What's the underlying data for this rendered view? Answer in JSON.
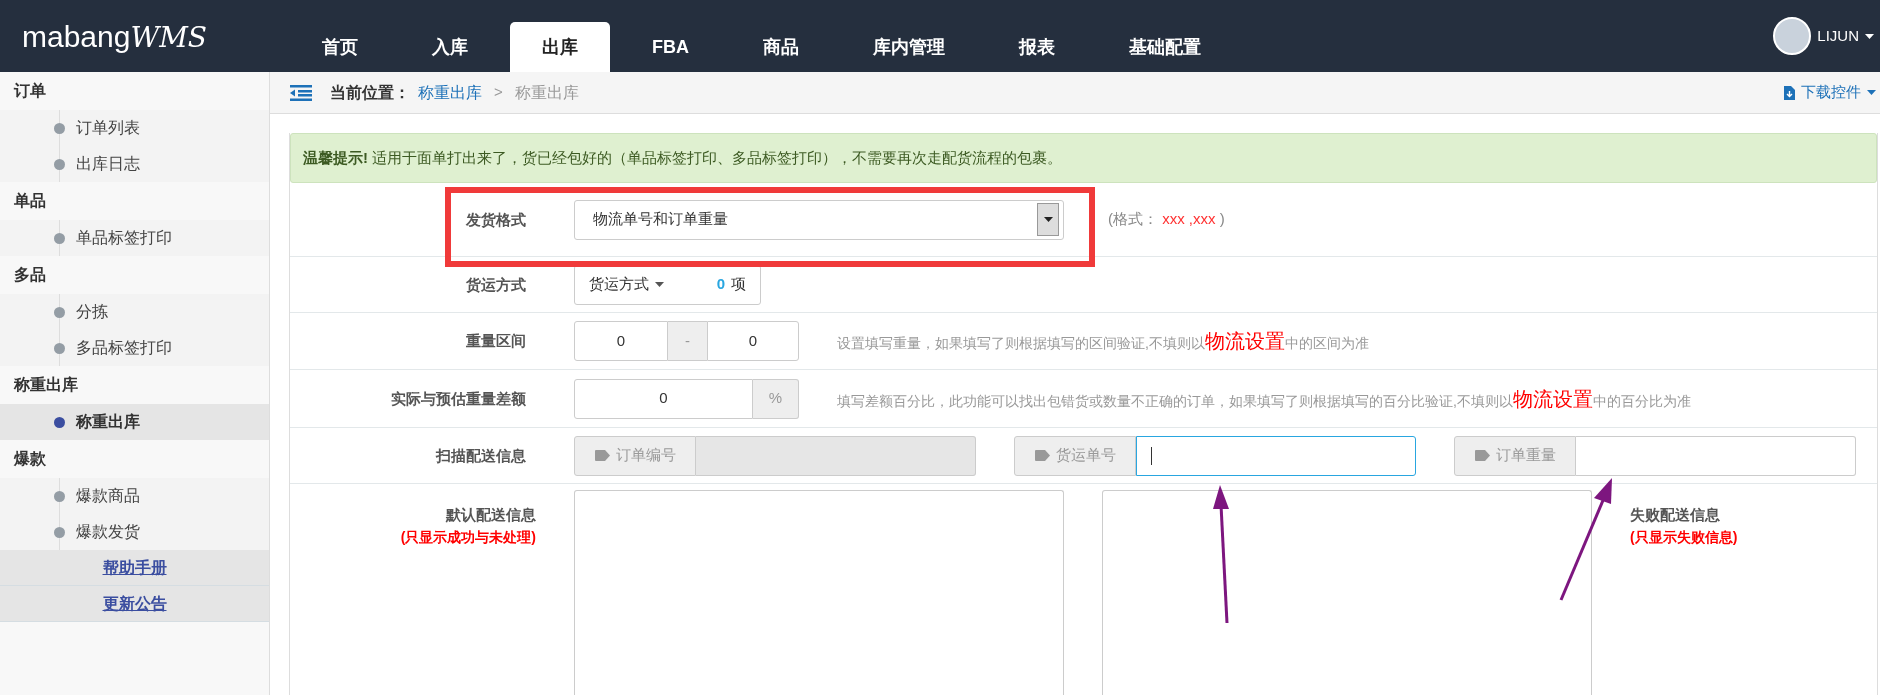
{
  "header": {
    "logo_main": "mabang",
    "logo_suffix": "WMS",
    "nav": [
      {
        "label": "首页",
        "selected": false
      },
      {
        "label": "入库",
        "selected": false
      },
      {
        "label": "出库",
        "selected": true
      },
      {
        "label": "FBA",
        "selected": false
      },
      {
        "label": "商品",
        "selected": false
      },
      {
        "label": "库内管理",
        "selected": false
      },
      {
        "label": "报表",
        "selected": false
      },
      {
        "label": "基础配置",
        "selected": false
      }
    ],
    "user": {
      "name": "LIJUN"
    }
  },
  "sidebar": {
    "sections": [
      {
        "title": "订单",
        "items": [
          {
            "label": "订单列表",
            "selected": false
          },
          {
            "label": "出库日志",
            "selected": false
          }
        ]
      },
      {
        "title": "单品",
        "items": [
          {
            "label": "单品标签打印",
            "selected": false
          }
        ]
      },
      {
        "title": "多品",
        "items": [
          {
            "label": "分拣",
            "selected": false
          },
          {
            "label": "多品标签打印",
            "selected": false
          }
        ]
      },
      {
        "title": "称重出库",
        "items": [
          {
            "label": "称重出库",
            "selected": true
          }
        ]
      },
      {
        "title": "爆款",
        "items": [
          {
            "label": "爆款商品",
            "selected": false
          },
          {
            "label": "爆款发货",
            "selected": false
          }
        ]
      }
    ],
    "links": [
      "帮助手册",
      "更新公告"
    ]
  },
  "breadcrumb": {
    "label": "当前位置：",
    "link": "称重出库",
    "separator": ">",
    "current": "称重出库",
    "download": "下载控件"
  },
  "alert": {
    "title": "温馨提示!",
    "text": "适用于面单打出来了，货已经包好的（单品标签打印、多品标签打印），不需要再次走配货流程的包裹。"
  },
  "form": {
    "ship_format": {
      "label": "发货格式",
      "value": "物流单号和订单重量",
      "hint_prefix": "(格式：",
      "hint_value": "xxx ,xxx",
      "hint_suffix": ")"
    },
    "shipping": {
      "label": "货运方式",
      "button": "货运方式",
      "count": "0",
      "unit": "项"
    },
    "weight_range": {
      "label": "重量区间",
      "min": "0",
      "separator": "-",
      "max": "0",
      "hint": {
        "before": "设置填写重量，如果填写了则根据填写的区间验证,不填则以",
        "emphasis": "物流设置",
        "after": "中的区间为准"
      }
    },
    "weight_diff": {
      "label": "实际与预估重量差额",
      "value": "0",
      "unit": "%",
      "hint": {
        "before": "填写差额百分比，此功能可以找出包错货或数量不正确的订单，如果填写了则根据填写的百分比验证,不填则以",
        "emphasis": "物流设置",
        "after": "中的百分比为准"
      }
    },
    "scan": {
      "label": "扫描配送信息",
      "fields": [
        {
          "label": "订单编号",
          "disabled": true,
          "focused": false
        },
        {
          "label": "货运单号",
          "disabled": false,
          "focused": true
        },
        {
          "label": "订单重量",
          "disabled": false,
          "focused": false
        }
      ]
    },
    "default_info": {
      "label": "默认配送信息",
      "note": "(只显示成功与未处理)"
    },
    "fail_info": {
      "label": "失败配送信息",
      "note": "(只显示失败信息)"
    }
  }
}
